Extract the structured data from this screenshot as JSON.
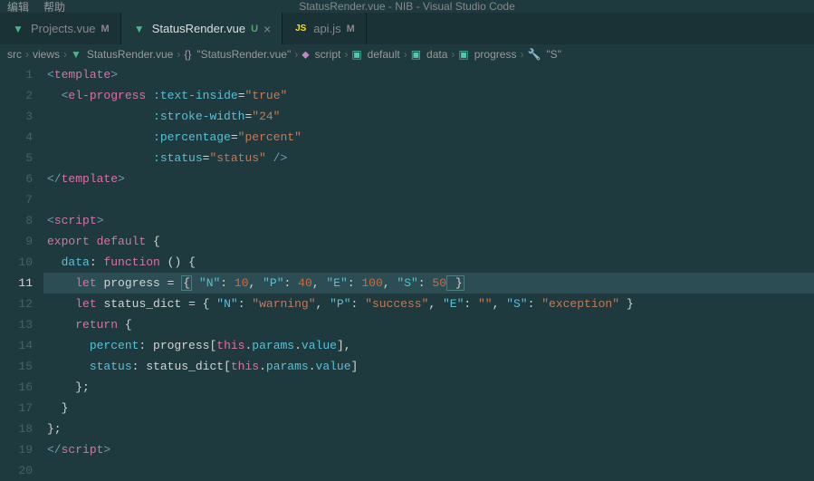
{
  "menubar": {
    "item1": "编辑",
    "item2": "帮助"
  },
  "title": "StatusRender.vue - NIB - Visual Studio Code",
  "tabs": [
    {
      "icon": "vue",
      "label": "Projects.vue",
      "status": "M",
      "active": false,
      "close": false
    },
    {
      "icon": "vue",
      "label": "StatusRender.vue",
      "status": "U",
      "active": true,
      "close": true
    },
    {
      "icon": "js",
      "label": "api.js",
      "status": "M",
      "active": false,
      "close": false
    }
  ],
  "breadcrumbs": [
    {
      "label": "src",
      "icon": ""
    },
    {
      "label": "views",
      "icon": ""
    },
    {
      "label": "StatusRender.vue",
      "icon": "vue"
    },
    {
      "label": "\"StatusRender.vue\"",
      "icon": "braces"
    },
    {
      "label": "script",
      "icon": "tag"
    },
    {
      "label": "default",
      "icon": "cube"
    },
    {
      "label": "data",
      "icon": "cube"
    },
    {
      "label": "progress",
      "icon": "cube"
    },
    {
      "label": "\"S\"",
      "icon": "wrench"
    }
  ],
  "lines": [
    1,
    2,
    3,
    4,
    5,
    6,
    7,
    8,
    9,
    10,
    11,
    12,
    13,
    14,
    15,
    16,
    17,
    18,
    19,
    20
  ],
  "activeLine": 11,
  "code": {
    "l1": {
      "tag_open": "<",
      "tag": "template",
      "tag_close": ">"
    },
    "l2": {
      "tag_open": "<",
      "tag": "el-progress",
      "attr1": ":text-inside",
      "eq": "=",
      "val1": "\"true\""
    },
    "l3": {
      "attr": ":stroke-width",
      "eq": "=",
      "val": "\"24\""
    },
    "l4": {
      "attr": ":percentage",
      "eq": "=",
      "val": "\"percent\""
    },
    "l5": {
      "attr": ":status",
      "eq": "=",
      "val": "\"status\"",
      "close": " />"
    },
    "l6": {
      "tag_open": "</",
      "tag": "template",
      "tag_close": ">"
    },
    "l8": {
      "tag_open": "<",
      "tag": "script",
      "tag_close": ">"
    },
    "l9": {
      "kw1": "export",
      "kw2": "default",
      "brace": " {"
    },
    "l10": {
      "prop": "data",
      "colon": ":",
      "kw": "function",
      "parens": " () {",
      "open": ""
    },
    "l11": {
      "kw": "let",
      "var": "progress",
      "eq": " = ",
      "lb": "{",
      "k1": "\"N\"",
      "c1": ": ",
      "v1": "10",
      "s1": ", ",
      "k2": "\"P\"",
      "c2": ": ",
      "v2": "40",
      "s2": ", ",
      "k3": "\"E\"",
      "c3": ": ",
      "v3": "100",
      "s3": ", ",
      "k4": "\"S\"",
      "c4": ": ",
      "v4": "50",
      "rb": " }"
    },
    "l12": {
      "kw": "let",
      "var": "status_dict",
      "eq": " = { ",
      "k1": "\"N\"",
      "c1": ": ",
      "v1": "\"warning\"",
      "s1": ", ",
      "k2": "\"P\"",
      "c2": ": ",
      "v2": "\"success\"",
      "s2": ", ",
      "k3": "\"E\"",
      "c3": ": ",
      "v3": "\"\"",
      "s3": ", ",
      "k4": "\"S\"",
      "c4": ": ",
      "v4": "\"exception\"",
      "rb": " }"
    },
    "l13": {
      "kw": "return",
      "brace": " {"
    },
    "l14": {
      "prop": "percent",
      "colon": ": ",
      "var": "progress",
      "lb": "[",
      "this": "this",
      "dot": ".",
      "p1": "params",
      "dot2": ".",
      "p2": "value",
      "rb": "],"
    },
    "l15": {
      "prop": "status",
      "colon": ": ",
      "var": "status_dict",
      "lb": "[",
      "this": "this",
      "dot": ".",
      "p1": "params",
      "dot2": ".",
      "p2": "value",
      "rb": "]"
    },
    "l16": {
      "brace": "};"
    },
    "l17": {
      "brace": "}"
    },
    "l18": {
      "brace": "};"
    },
    "l19": {
      "tag_open": "</",
      "tag": "script",
      "tag_close": ">"
    }
  }
}
